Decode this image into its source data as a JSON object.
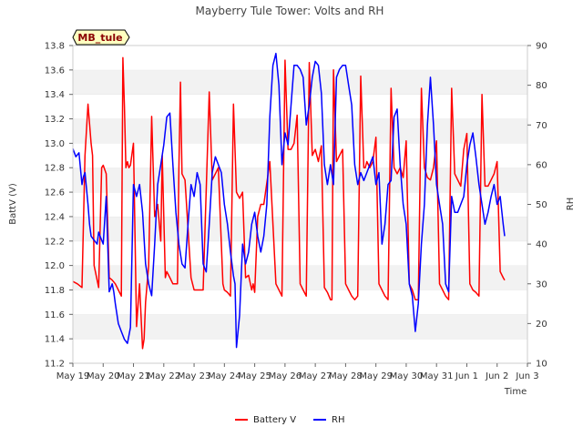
{
  "chart_data": {
    "type": "line",
    "title": "Mayberry Tule Tower: Volts and RH",
    "xlabel": "Time",
    "ylabel_left": "BattV (V)",
    "ylabel_right": "RH",
    "annotation": "MB_tule",
    "grid": "horizontal bands",
    "legend_position": "bottom-center",
    "x_range": [
      "May 19",
      "Jun 3"
    ],
    "x_tick_labels": [
      "May 19",
      "May 20",
      "May 21",
      "May 22",
      "May 23",
      "May 24",
      "May 25",
      "May 26",
      "May 27",
      "May 28",
      "May 29",
      "May 30",
      "May 31",
      "Jun 1",
      "Jun 2",
      "Jun 3"
    ],
    "y_left_range": [
      11.2,
      13.8
    ],
    "y_left_ticks": [
      "11.2",
      "11.4",
      "11.6",
      "11.8",
      "12.0",
      "12.2",
      "12.4",
      "12.6",
      "12.8",
      "13.0",
      "13.2",
      "13.4",
      "13.6",
      "13.8"
    ],
    "y_right_range": [
      10,
      90
    ],
    "y_right_ticks": [
      "10",
      "20",
      "30",
      "40",
      "50",
      "60",
      "70",
      "80",
      "90"
    ],
    "series": [
      {
        "name": "Battery V",
        "color": "#ff0000",
        "axis": "left",
        "x": [
          0.0,
          0.15,
          0.3,
          0.4,
          0.5,
          0.6,
          0.65,
          0.7,
          0.85,
          0.95,
          1.0,
          1.1,
          1.2,
          1.3,
          1.4,
          1.5,
          1.6,
          1.65,
          1.7,
          1.75,
          1.8,
          1.85,
          1.9,
          2.0,
          2.1,
          2.2,
          2.3,
          2.35,
          2.4,
          2.5,
          2.6,
          2.7,
          2.8,
          2.9,
          2.95,
          3.0,
          3.05,
          3.1,
          3.2,
          3.3,
          3.45,
          3.5,
          3.55,
          3.6,
          3.7,
          3.9,
          3.95,
          4.0,
          4.2,
          4.3,
          4.5,
          4.6,
          4.7,
          4.8,
          4.95,
          5.0,
          5.1,
          5.2,
          5.3,
          5.4,
          5.5,
          5.6,
          5.7,
          5.8,
          5.9,
          5.95,
          6.0,
          6.1,
          6.2,
          6.3,
          6.5,
          6.7,
          6.8,
          6.9,
          7.0,
          7.1,
          7.2,
          7.3,
          7.4,
          7.5,
          7.6,
          7.7,
          7.8,
          7.9,
          8.0,
          8.1,
          8.2,
          8.3,
          8.4,
          8.5,
          8.55,
          8.6,
          8.7,
          8.8,
          8.9,
          9.0,
          9.1,
          9.2,
          9.3,
          9.4,
          9.5,
          9.6,
          9.65,
          9.7,
          9.8,
          9.9,
          10.0,
          10.1,
          10.2,
          10.3,
          10.4,
          10.5,
          10.6,
          10.7,
          10.8,
          10.9,
          11.0,
          11.1,
          11.2,
          11.3,
          11.4,
          11.5,
          11.6,
          11.7,
          11.8,
          11.9,
          12.0,
          12.1,
          12.2,
          12.3,
          12.4,
          12.5,
          12.6,
          12.7,
          12.8,
          12.9,
          13.0,
          13.1,
          13.2,
          13.3,
          13.4,
          13.5,
          13.6,
          13.7,
          13.8,
          13.9,
          14.0,
          14.1,
          14.2,
          14.25
        ],
        "values": [
          11.87,
          11.85,
          11.82,
          12.9,
          13.32,
          13.0,
          12.9,
          12.0,
          11.82,
          12.8,
          12.82,
          12.75,
          11.9,
          11.88,
          11.85,
          11.8,
          11.75,
          13.7,
          13.3,
          12.8,
          12.85,
          12.8,
          12.82,
          13.0,
          11.5,
          11.85,
          11.32,
          11.4,
          11.7,
          12.0,
          13.22,
          12.4,
          12.5,
          12.2,
          12.9,
          12.4,
          11.9,
          11.95,
          11.9,
          11.85,
          11.85,
          12.8,
          13.5,
          12.75,
          12.7,
          11.9,
          11.85,
          11.8,
          11.8,
          11.8,
          13.42,
          12.7,
          12.75,
          12.8,
          11.85,
          11.8,
          11.78,
          11.75,
          13.32,
          12.6,
          12.55,
          12.6,
          11.9,
          11.92,
          11.8,
          11.85,
          11.78,
          12.4,
          12.5,
          12.5,
          12.85,
          11.85,
          11.8,
          11.75,
          13.68,
          12.95,
          12.95,
          13.0,
          13.23,
          11.85,
          11.8,
          11.75,
          13.66,
          12.9,
          12.95,
          12.85,
          12.98,
          11.82,
          11.78,
          11.72,
          11.72,
          13.6,
          12.85,
          12.9,
          12.95,
          11.85,
          11.8,
          11.75,
          11.72,
          11.75,
          13.55,
          12.8,
          12.8,
          12.85,
          12.8,
          12.85,
          13.05,
          11.85,
          11.8,
          11.75,
          11.72,
          13.45,
          12.8,
          12.75,
          12.8,
          12.72,
          13.02,
          11.85,
          11.8,
          11.72,
          11.72,
          13.45,
          12.8,
          12.72,
          12.7,
          12.8,
          13.02,
          11.85,
          11.8,
          11.75,
          11.72,
          13.45,
          12.75,
          12.7,
          12.65,
          12.95,
          13.08,
          11.85,
          11.8,
          11.78,
          11.75,
          13.4,
          12.65,
          12.65,
          12.7,
          12.75,
          12.85,
          11.95,
          11.9,
          11.88
        ]
      },
      {
        "name": "RH",
        "color": "#0000ff",
        "axis": "right",
        "x": [
          0.0,
          0.1,
          0.2,
          0.3,
          0.35,
          0.4,
          0.5,
          0.55,
          0.6,
          0.7,
          0.8,
          0.85,
          0.9,
          1.0,
          1.1,
          1.2,
          1.3,
          1.35,
          1.4,
          1.5,
          1.6,
          1.7,
          1.8,
          1.9,
          2.0,
          2.1,
          2.2,
          2.3,
          2.4,
          2.5,
          2.6,
          2.7,
          2.8,
          2.9,
          3.0,
          3.1,
          3.2,
          3.3,
          3.4,
          3.5,
          3.6,
          3.7,
          3.8,
          3.9,
          4.0,
          4.1,
          4.2,
          4.3,
          4.4,
          4.5,
          4.6,
          4.7,
          4.8,
          4.9,
          5.0,
          5.1,
          5.2,
          5.3,
          5.35,
          5.4,
          5.5,
          5.6,
          5.7,
          5.8,
          5.9,
          6.0,
          6.1,
          6.2,
          6.3,
          6.4,
          6.5,
          6.6,
          6.7,
          6.8,
          6.9,
          7.0,
          7.1,
          7.2,
          7.3,
          7.4,
          7.5,
          7.6,
          7.7,
          7.8,
          7.9,
          8.0,
          8.1,
          8.2,
          8.3,
          8.4,
          8.5,
          8.6,
          8.7,
          8.8,
          8.9,
          9.0,
          9.1,
          9.2,
          9.3,
          9.4,
          9.5,
          9.6,
          9.7,
          9.8,
          9.9,
          10.0,
          10.1,
          10.2,
          10.3,
          10.4,
          10.5,
          10.6,
          10.7,
          10.8,
          10.9,
          11.0,
          11.1,
          11.2,
          11.3,
          11.4,
          11.5,
          11.6,
          11.7,
          11.8,
          11.9,
          12.0,
          12.1,
          12.2,
          12.3,
          12.4,
          12.5,
          12.6,
          12.7,
          12.8,
          12.9,
          13.0,
          13.1,
          13.2,
          13.3,
          13.4,
          13.5,
          13.6,
          13.7,
          13.8,
          13.9,
          14.0,
          14.1,
          14.2,
          14.25
        ],
        "values": [
          64,
          62,
          63,
          55,
          57,
          58,
          50,
          45,
          42,
          41,
          40,
          43,
          42,
          40,
          52,
          28,
          30,
          28,
          25,
          20,
          18,
          16,
          15,
          19,
          55,
          52,
          55,
          48,
          35,
          30,
          27,
          40,
          55,
          60,
          65,
          72,
          73,
          60,
          48,
          40,
          35,
          34,
          45,
          55,
          52,
          58,
          55,
          35,
          33,
          45,
          58,
          62,
          60,
          58,
          50,
          45,
          38,
          32,
          30,
          14,
          22,
          40,
          35,
          38,
          45,
          48,
          42,
          38,
          42,
          50,
          72,
          85,
          88,
          80,
          60,
          68,
          65,
          75,
          85,
          85,
          84,
          82,
          70,
          75,
          82,
          86,
          85,
          78,
          60,
          55,
          60,
          55,
          82,
          84,
          85,
          85,
          80,
          75,
          60,
          55,
          58,
          56,
          58,
          60,
          62,
          55,
          58,
          40,
          45,
          55,
          56,
          72,
          74,
          60,
          50,
          45,
          30,
          27,
          18,
          25,
          40,
          50,
          70,
          82,
          70,
          55,
          50,
          45,
          30,
          28,
          52,
          48,
          48,
          50,
          52,
          60,
          65,
          68,
          62,
          55,
          50,
          45,
          48,
          52,
          55,
          50,
          52,
          45,
          42
        ]
      }
    ]
  }
}
